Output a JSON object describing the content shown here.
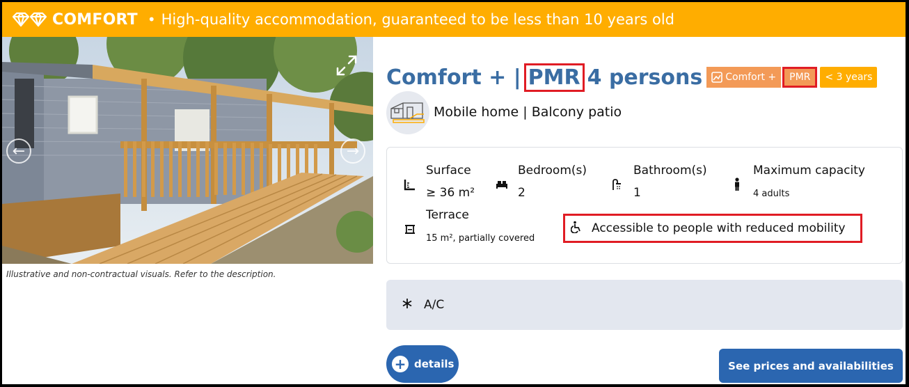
{
  "banner": {
    "brand": "COMFORT",
    "separator": "•",
    "tagline": "High-quality accommodation, guaranteed to be less than 10 years old",
    "bg_color": "#ffad00"
  },
  "gallery": {
    "caption": "Illustrative and non-contractual visuals. Refer to the description.",
    "prev_icon": "arrow-left-icon",
    "next_icon": "arrow-right-icon",
    "expand_icon": "expand-icon"
  },
  "title": {
    "part1": "Comfort + |",
    "highlight": "PMR",
    "part2": "4 persons",
    "color": "#3a6da3",
    "highlight_border": "#e01c24"
  },
  "badges": {
    "comfort": "Comfort +",
    "pmr": "PMR",
    "age": "< 3 years"
  },
  "subtype": {
    "label": "Mobile home | Balcony patio",
    "icon": "mobile-home-icon"
  },
  "specs": {
    "surface": {
      "label": "Surface",
      "value": "≥ 36 m²",
      "icon": "ruler-icon"
    },
    "bedrooms": {
      "label": "Bedroom(s)",
      "value": "2",
      "icon": "bed-icon"
    },
    "bathrooms": {
      "label": "Bathroom(s)",
      "value": "1",
      "icon": "shower-icon"
    },
    "capacity": {
      "label": "Maximum capacity",
      "value": "4 adults",
      "icon": "person-icon"
    },
    "terrace": {
      "label": "Terrace",
      "value": "15 m², partially covered",
      "icon": "terrace-icon"
    },
    "accessibility": {
      "label": "Accessible to people with reduced mobility",
      "icon": "wheelchair-icon"
    }
  },
  "equipment": {
    "ac": {
      "label": "A/C",
      "icon": "snowflake-icon"
    }
  },
  "buttons": {
    "details": "details",
    "prices": "See prices and availabilities",
    "accent": "#2b66b0"
  }
}
